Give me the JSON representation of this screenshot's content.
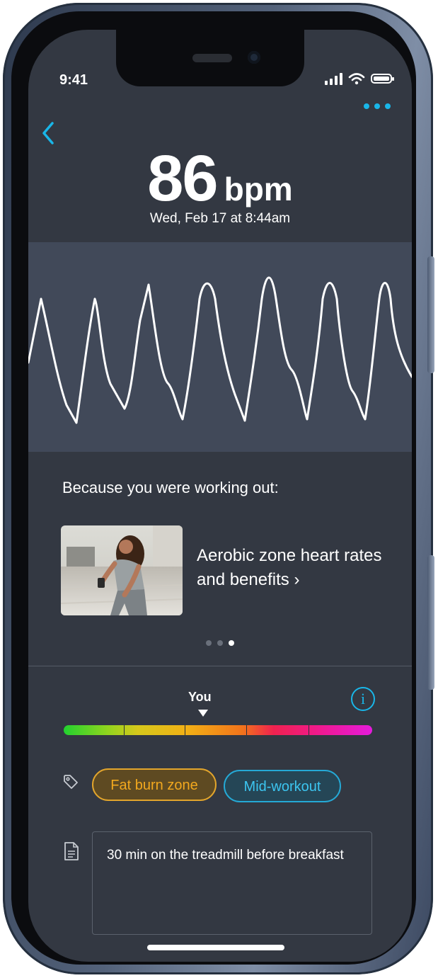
{
  "status_bar": {
    "time": "9:41"
  },
  "header": {
    "back_icon": "chevron-left-icon",
    "more_icon": "more-dots-icon",
    "accent_color": "#19b6e8"
  },
  "reading": {
    "value": "86",
    "unit": "bpm",
    "timestamp": "Wed, Feb 17 at 8:44am"
  },
  "heart_graph": {
    "type": "line",
    "line_color": "#ffffff",
    "background_color": "#414959"
  },
  "recommendation": {
    "heading": "Because you were working out:",
    "article_title": "Aerobic zone heart rates and benefits ›",
    "pager": {
      "count": 3,
      "active_index": 2
    }
  },
  "zone": {
    "marker_label": "You",
    "info_icon": "info-icon",
    "segments": 5,
    "marker_position_fraction": 0.45
  },
  "tags": {
    "icon": "tag-icon",
    "items": [
      {
        "label": "Fat burn zone",
        "color": "#f2a81e"
      },
      {
        "label": "Mid-workout",
        "color": "#3cc5f0"
      }
    ]
  },
  "note": {
    "icon": "note-icon",
    "text": "30 min on the treadmill before breakfast"
  }
}
